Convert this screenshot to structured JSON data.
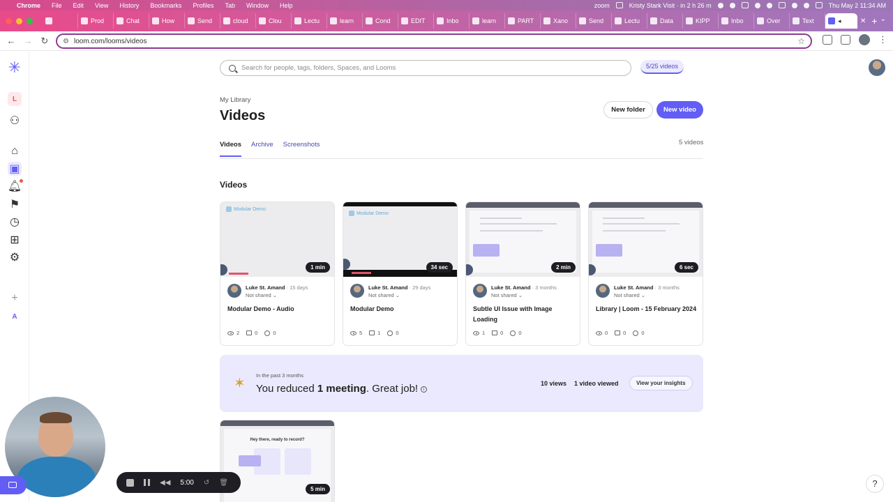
{
  "menubar": {
    "app": "Chrome",
    "items": [
      "File",
      "Edit",
      "View",
      "History",
      "Bookmarks",
      "Profiles",
      "Tab",
      "Window",
      "Help"
    ],
    "zoom_label": "zoom",
    "meeting": "Kristy Stark Visit · in 2 h 26 m",
    "clock": "Thu May 2  11:34 AM"
  },
  "tabs": [
    "Prod",
    "Chat",
    "How",
    "Send",
    "cloud",
    "Clou",
    "Lectu",
    "learn",
    "Cond",
    "EDIT",
    "Inbo",
    "learn",
    "PART",
    "Xano",
    "Send",
    "Lectu",
    "Data",
    "KIPP",
    "Inbo",
    "Over",
    "Text"
  ],
  "address": {
    "url": "loom.com/looms/videos"
  },
  "search": {
    "placeholder": "Search for people, tags, folders, Spaces, and Looms"
  },
  "quota": "5/25 videos",
  "breadcrumb": "My Library",
  "title": "Videos",
  "buttons": {
    "new_folder": "New folder",
    "new_video": "New video"
  },
  "library_tabs": [
    "Videos",
    "Archive",
    "Screenshots"
  ],
  "video_count": "5 videos",
  "section_title": "Videos",
  "videos": [
    {
      "duration": "1 min",
      "author": "Luke St. Amand",
      "age": "· 15 days",
      "sharing": "Not shared",
      "title": "Modular Demo - Audio",
      "views": "2",
      "comments": "0",
      "reactions": "0",
      "thumb_label": "Modular Demo"
    },
    {
      "duration": "34 sec",
      "author": "Luke St. Amand",
      "age": "· 29 days",
      "sharing": "Not shared",
      "title": "Modular Demo",
      "views": "5",
      "comments": "1",
      "reactions": "0",
      "thumb_label": "Modular Demo"
    },
    {
      "duration": "2 min",
      "author": "Luke St. Amand",
      "age": "· 3 months",
      "sharing": "Not shared",
      "title": "Subtle UI Issue with Image Loading",
      "views": "1",
      "comments": "0",
      "reactions": "0"
    },
    {
      "duration": "6 sec",
      "author": "Luke St. Amand",
      "age": "· 3 months",
      "sharing": "Not shared",
      "title": "Library | Loom - 15 February 2024",
      "views": "0",
      "comments": "0",
      "reactions": "0"
    }
  ],
  "insights": {
    "period": "In the past 3 months",
    "message_prefix": "You reduced ",
    "message_bold": "1 meeting",
    "message_suffix": ". Great job!",
    "views": "10 views",
    "viewed": "1 video viewed",
    "cta": "View your insights"
  },
  "video5": {
    "duration": "5 min",
    "thumb_heading": "Hey there, ready to record?"
  },
  "recorder": {
    "time": "5:00"
  },
  "help": "?"
}
